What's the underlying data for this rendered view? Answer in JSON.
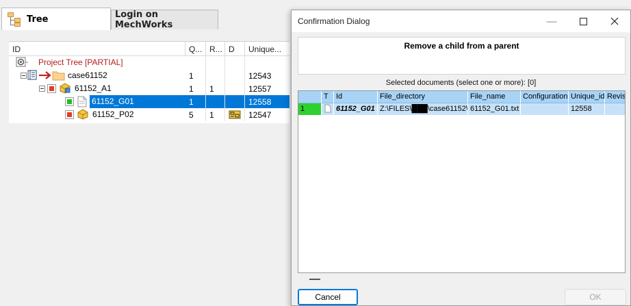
{
  "tabs": [
    {
      "label": "Tree",
      "icon": "tree-icon",
      "active": true
    },
    {
      "label": "Login on MechWorks",
      "active": false
    }
  ],
  "tree": {
    "columns": [
      "ID",
      "Q...",
      "R...",
      "D",
      "Unique..."
    ],
    "rows": [
      {
        "label": "Project Tree [PARTIAL]",
        "q": "",
        "r": "",
        "d": "",
        "unique": "",
        "icon": "project-icon"
      },
      {
        "label": "case61152",
        "q": "1",
        "r": "",
        "d": "",
        "unique": "12543",
        "icon": "folder-icon"
      },
      {
        "label": "61152_A1",
        "q": "1",
        "r": "1",
        "d": "",
        "unique": "12557",
        "icon": "assembly-icon"
      },
      {
        "label": "61152_G01",
        "q": "1",
        "r": "",
        "d": "",
        "unique": "12558",
        "icon": "document-icon",
        "selected": true
      },
      {
        "label": "61152_P02",
        "q": "5",
        "r": "1",
        "d": "drawing-icon",
        "unique": "12547",
        "icon": "part-icon"
      }
    ]
  },
  "dialog": {
    "title": "Confirmation Dialog",
    "banner_title": "Remove a child from a parent",
    "selection_label": "Selected documents (select one or more): [0]",
    "grid": {
      "columns": [
        "",
        "T",
        "Id",
        "File_directory",
        "File_name",
        "Configuration",
        "Unique_id",
        "Revis"
      ],
      "rows": [
        {
          "num": "1",
          "t": "",
          "id": "61152_G01",
          "dir": "Z:\\FILES\\███\\case61152\\",
          "file": "61152_G01.txt",
          "config": "",
          "unique": "12558",
          "rev": ""
        }
      ]
    },
    "cancel_label": "Cancel",
    "ok_label": "OK"
  },
  "colors": {
    "selection": "#0078d7",
    "grid_header": "#a7d3f7",
    "grid_row": "#c7e2f8",
    "status_green": "#2fcf2f",
    "red_mark": "#e53c24"
  }
}
